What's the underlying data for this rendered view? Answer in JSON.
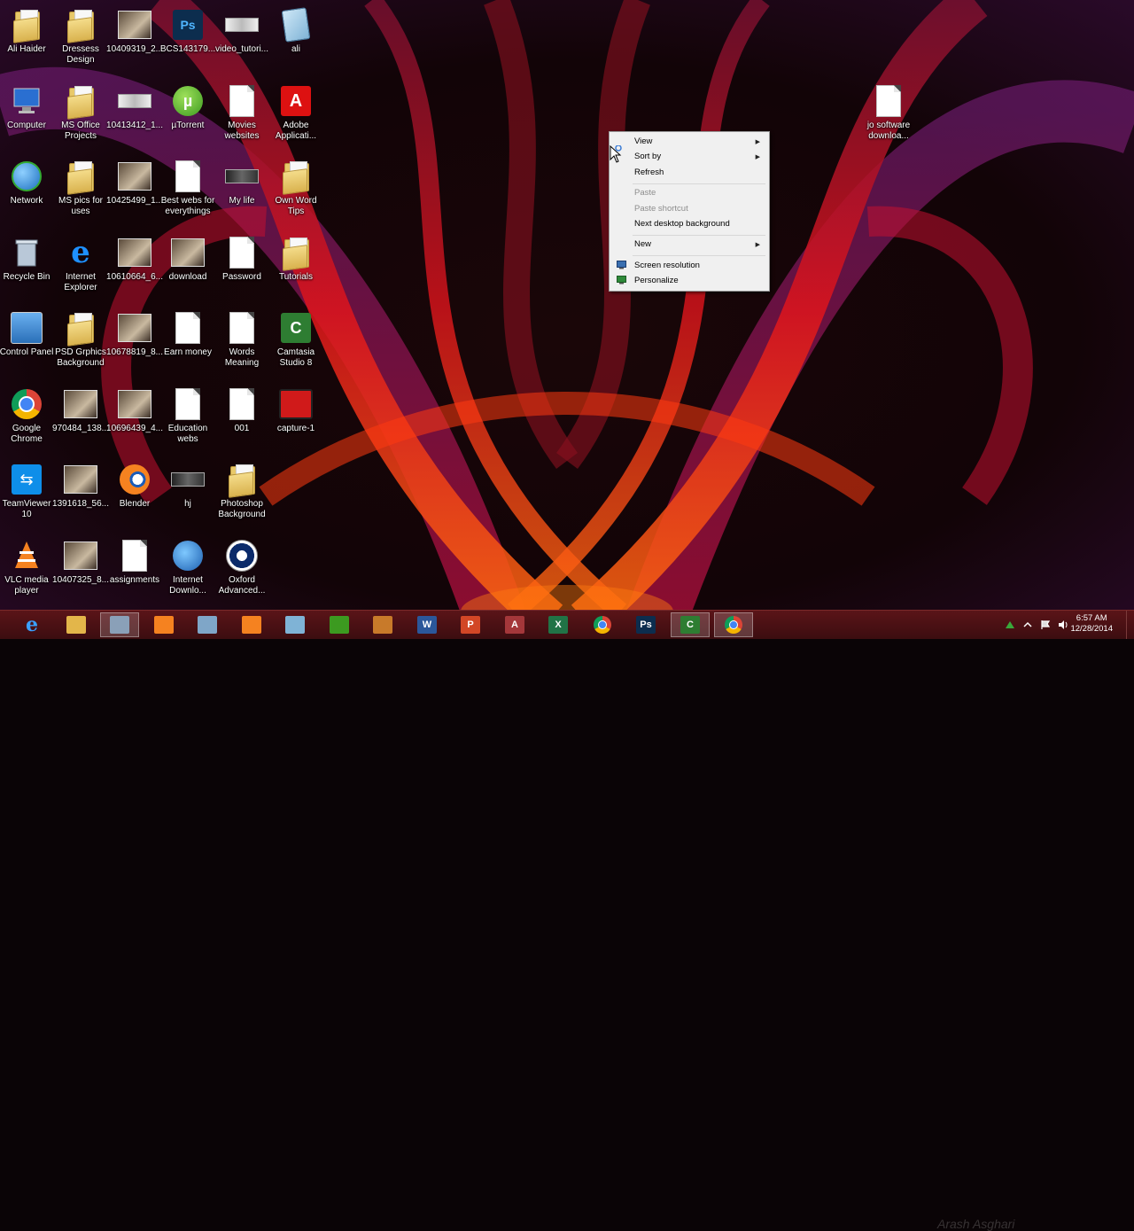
{
  "desktop": {
    "icons": [
      {
        "label": "Ali Haider",
        "kind": "folder"
      },
      {
        "label": "Dressess Design",
        "kind": "folder"
      },
      {
        "label": "10409319_2...",
        "kind": "photo"
      },
      {
        "label": "BCS143179...",
        "kind": "psd"
      },
      {
        "label": "video_tutori...",
        "kind": "thumb-light"
      },
      {
        "label": "ali",
        "kind": "notepad"
      },
      {
        "label": "Computer",
        "kind": "computer"
      },
      {
        "label": "MS Office Projects",
        "kind": "folder"
      },
      {
        "label": "10413412_1...",
        "kind": "thumb-light"
      },
      {
        "label": "µTorrent",
        "kind": "utorrent"
      },
      {
        "label": "Movies websites",
        "kind": "doc"
      },
      {
        "label": "Adobe Applicati...",
        "kind": "adobe"
      },
      {
        "label": "jo software downloa...",
        "kind": "doc"
      },
      {
        "label": "Network",
        "kind": "network"
      },
      {
        "label": "MS pics for uses",
        "kind": "folder"
      },
      {
        "label": "10425499_1...",
        "kind": "photo"
      },
      {
        "label": "Best webs for everythings",
        "kind": "doc"
      },
      {
        "label": "My life",
        "kind": "thumb-dark"
      },
      {
        "label": "Own Word Tips",
        "kind": "folder"
      },
      {
        "label": "Recycle Bin",
        "kind": "recycle"
      },
      {
        "label": "Internet Explorer",
        "kind": "ie"
      },
      {
        "label": "10610664_6...",
        "kind": "photo"
      },
      {
        "label": "download",
        "kind": "photo"
      },
      {
        "label": "Password",
        "kind": "doc"
      },
      {
        "label": "Tutorials",
        "kind": "folder"
      },
      {
        "label": "Control Panel",
        "kind": "controlpanel"
      },
      {
        "label": "PSD Grphics Background",
        "kind": "folder"
      },
      {
        "label": "10678819_8...",
        "kind": "photo"
      },
      {
        "label": "Earn money",
        "kind": "doc"
      },
      {
        "label": "Words Meaning",
        "kind": "doc"
      },
      {
        "label": "Camtasia Studio 8",
        "kind": "camtasia"
      },
      {
        "label": "Google Chrome",
        "kind": "chrome"
      },
      {
        "label": "970484_138...",
        "kind": "photo"
      },
      {
        "label": "10696439_4...",
        "kind": "photo"
      },
      {
        "label": "Education webs",
        "kind": "doc"
      },
      {
        "label": "001",
        "kind": "doc"
      },
      {
        "label": "capture-1",
        "kind": "capture"
      },
      {
        "label": "TeamViewer 10",
        "kind": "teamviewer"
      },
      {
        "label": "1391618_56...",
        "kind": "photo"
      },
      {
        "label": "Blender",
        "kind": "blender"
      },
      {
        "label": "hj",
        "kind": "thumb-dark"
      },
      {
        "label": "Photoshop Background",
        "kind": "folder"
      },
      {
        "label": "VLC media player",
        "kind": "vlc"
      },
      {
        "label": "10407325_8...",
        "kind": "photo"
      },
      {
        "label": "assignments",
        "kind": "doc"
      },
      {
        "label": "Internet Downlo...",
        "kind": "idm"
      },
      {
        "label": "Oxford Advanced...",
        "kind": "oxford"
      }
    ]
  },
  "context_menu": {
    "items": [
      {
        "label": "View",
        "submenu": true,
        "disabled": false
      },
      {
        "label": "Sort by",
        "submenu": true,
        "disabled": false
      },
      {
        "label": "Refresh",
        "submenu": false,
        "disabled": false
      },
      {
        "label": "Paste",
        "submenu": false,
        "disabled": true
      },
      {
        "label": "Paste shortcut",
        "submenu": false,
        "disabled": true
      },
      {
        "label": "Next desktop background",
        "submenu": false,
        "disabled": false
      },
      {
        "label": "New",
        "submenu": true,
        "disabled": false
      },
      {
        "label": "Screen resolution",
        "submenu": false,
        "disabled": false,
        "icon": "screen-resolution-icon"
      },
      {
        "label": "Personalize",
        "submenu": false,
        "disabled": false,
        "icon": "personalize-icon"
      }
    ],
    "submenu_arrow": "▶"
  },
  "taskbar": {
    "apps": [
      {
        "name": "internet-explorer",
        "active": false
      },
      {
        "name": "file-explorer",
        "active": false
      },
      {
        "name": "control-panel",
        "active": true
      },
      {
        "name": "vlc",
        "active": false
      },
      {
        "name": "network-settings",
        "active": false
      },
      {
        "name": "blender",
        "active": false
      },
      {
        "name": "notepad",
        "active": false
      },
      {
        "name": "utorrent",
        "active": false
      },
      {
        "name": "toolbox",
        "active": false
      },
      {
        "name": "word",
        "active": false,
        "glyph": "W"
      },
      {
        "name": "powerpoint",
        "active": false,
        "glyph": "P"
      },
      {
        "name": "access",
        "active": false,
        "glyph": "A"
      },
      {
        "name": "excel",
        "active": false,
        "glyph": "X"
      },
      {
        "name": "chrome",
        "active": false
      },
      {
        "name": "photoshop",
        "active": false,
        "glyph": "Ps"
      },
      {
        "name": "camtasia",
        "active": true,
        "glyph": "C"
      },
      {
        "name": "chrome-2",
        "active": true
      }
    ],
    "clock": {
      "time": "6:57 AM",
      "date": "12/28/2014"
    },
    "watermark": "Arash Asghari"
  },
  "colors": {
    "word": "#2b579a",
    "powerpoint": "#d24726",
    "access": "#a4373a",
    "excel": "#217346",
    "photoshop": "#0c2d4e",
    "camtasia": "#2e7d32"
  }
}
